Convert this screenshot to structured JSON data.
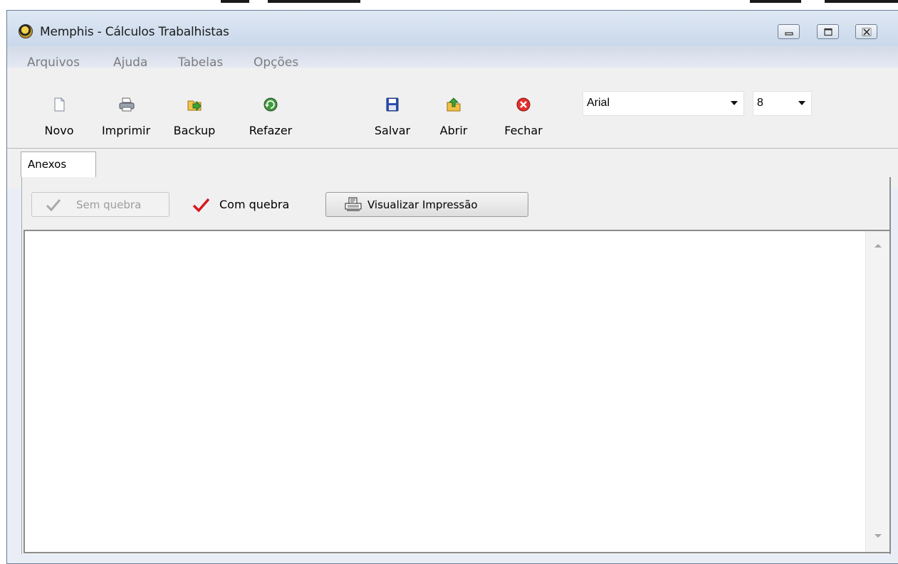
{
  "window": {
    "title": "Memphis - Cálculos Trabalhistas"
  },
  "menu": [
    "Arquivos",
    "Ajuda",
    "Tabelas",
    "Opções"
  ],
  "toolbar": {
    "novo": "Novo",
    "imprimir": "Imprimir",
    "backup": "Backup",
    "refazer": "Refazer",
    "salvar": "Salvar",
    "abrir": "Abrir",
    "fechar": "Fechar",
    "font_family": "Arial",
    "font_size": "8"
  },
  "tabs": [
    {
      "label": "Anexos"
    }
  ],
  "actions": {
    "sem_quebra": "Sem quebra",
    "com_quebra": "Com quebra",
    "visualizar": "Visualizar Impressão"
  },
  "editor": {
    "text": ""
  },
  "colors": {
    "accent_check": "#d6161c",
    "disabled_text": "#9c9c9c",
    "menu_text": "#7c7c7c"
  },
  "icons": [
    "app-logo-icon",
    "minimize-icon",
    "maximize-icon",
    "close-icon",
    "new-document-icon",
    "printer-icon",
    "backup-icon",
    "redo-icon",
    "floppy-save-icon",
    "open-folder-icon",
    "close-red-icon",
    "checkmark-icon",
    "print-preview-icon",
    "scroll-up-icon",
    "scroll-down-icon"
  ]
}
